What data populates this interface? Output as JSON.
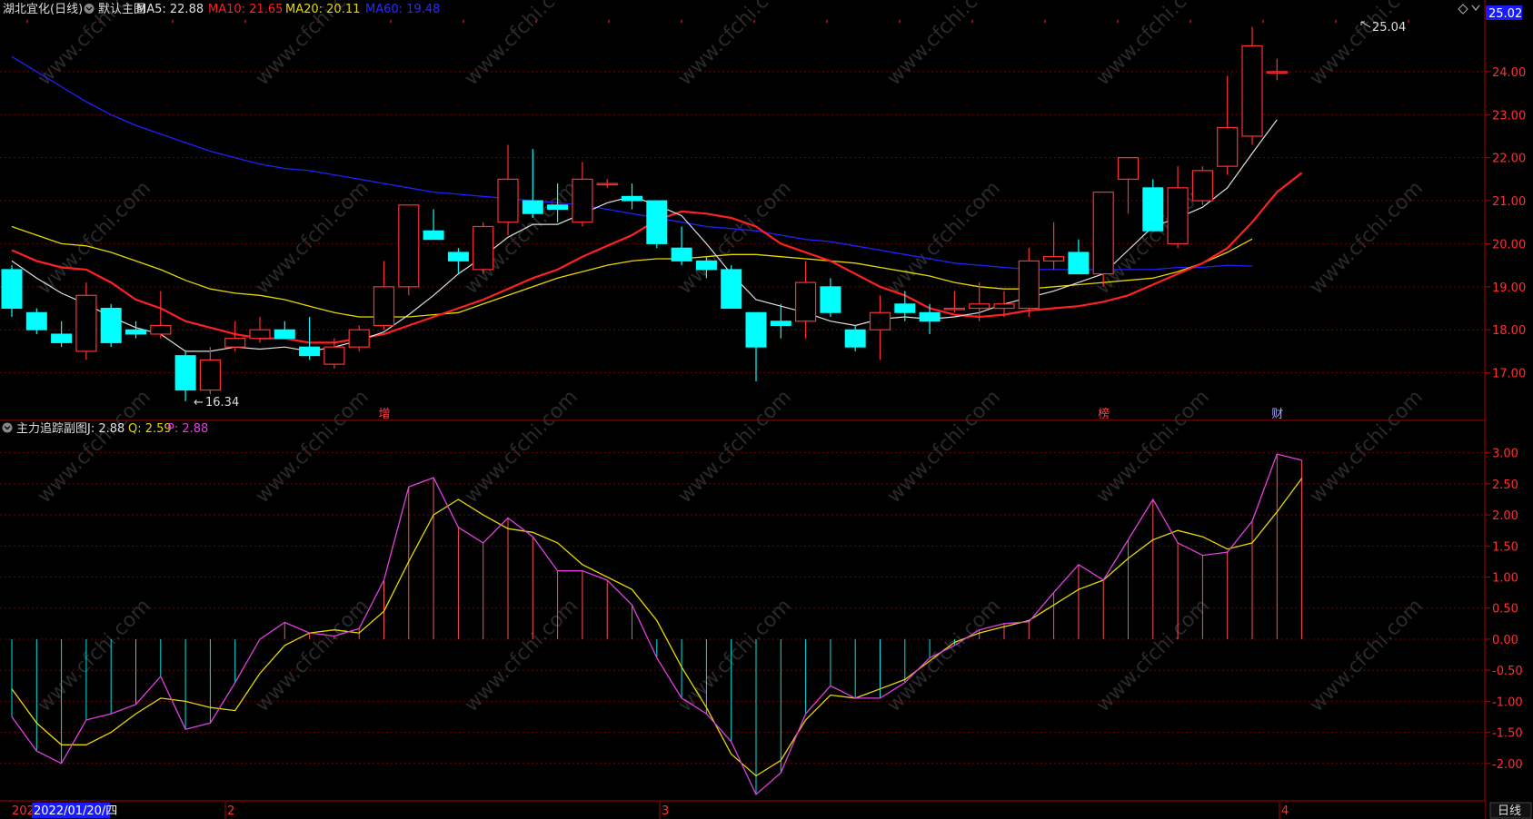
{
  "header": {
    "stock": "湖北宜化(日线)",
    "main_chart": "默认主图",
    "ma5": {
      "label": "MA5: 22.88",
      "color": "#e0e0e0"
    },
    "ma10": {
      "label": "MA10: 21.65",
      "color": "#ff2020"
    },
    "ma20": {
      "label": "MA20: 20.11",
      "color": "#e6d800"
    },
    "ma60": {
      "label": "MA60: 19.48",
      "color": "#2020ff"
    },
    "price_badge": "25.02"
  },
  "sub_header": {
    "title": "主力追踪副图",
    "j": {
      "label": "J: 2.88",
      "color": "#e0e0e0"
    },
    "q": {
      "label": "Q: 2.59",
      "color": "#e6d800"
    },
    "p": {
      "label": "P: 2.88",
      "color": "#e040e0"
    }
  },
  "markers": {
    "low_label": "16.34",
    "high_label": "25.04",
    "events": [
      {
        "index": 15,
        "text": "增"
      },
      {
        "index": 44,
        "text": "榜"
      },
      {
        "index": 51,
        "text": "财"
      }
    ]
  },
  "bottom_bar": {
    "date_prefix": "202",
    "date_label": "2022/01/20/四",
    "month_2": "2",
    "month_3": "3",
    "month_4": "4",
    "period": "日线"
  },
  "watermark": "www.cfchi.com",
  "colors": {
    "up": "#ff3030",
    "down": "#00ffff",
    "grid": "#7a0000",
    "axis": "#b00000",
    "bg": "#000000"
  },
  "chart_data": [
    {
      "type": "candlestick",
      "title": "湖北宜化(日线)",
      "ylim": [
        16.0,
        25.2
      ],
      "yticks": [
        "17.00",
        "18.00",
        "19.00",
        "20.00",
        "21.00",
        "22.00",
        "23.00",
        "24.00"
      ],
      "candles": [
        {
          "o": 19.4,
          "h": 19.5,
          "l": 18.3,
          "c": 18.5
        },
        {
          "o": 18.4,
          "h": 18.5,
          "l": 17.9,
          "c": 18.0
        },
        {
          "o": 17.9,
          "h": 18.2,
          "l": 17.6,
          "c": 17.7
        },
        {
          "o": 17.5,
          "h": 19.1,
          "l": 17.3,
          "c": 18.8
        },
        {
          "o": 18.5,
          "h": 18.6,
          "l": 17.6,
          "c": 17.7
        },
        {
          "o": 18.0,
          "h": 18.2,
          "l": 17.8,
          "c": 17.9
        },
        {
          "o": 17.9,
          "h": 18.9,
          "l": 17.8,
          "c": 18.1
        },
        {
          "o": 17.4,
          "h": 17.5,
          "l": 16.34,
          "c": 16.6
        },
        {
          "o": 16.6,
          "h": 17.6,
          "l": 16.5,
          "c": 17.3
        },
        {
          "o": 17.6,
          "h": 18.2,
          "l": 17.5,
          "c": 17.8
        },
        {
          "o": 17.8,
          "h": 18.3,
          "l": 17.7,
          "c": 18.0
        },
        {
          "o": 18.0,
          "h": 18.2,
          "l": 17.8,
          "c": 17.8
        },
        {
          "o": 17.6,
          "h": 18.3,
          "l": 17.3,
          "c": 17.4
        },
        {
          "o": 17.2,
          "h": 17.8,
          "l": 17.1,
          "c": 17.6
        },
        {
          "o": 17.6,
          "h": 18.1,
          "l": 17.5,
          "c": 18.0
        },
        {
          "o": 18.1,
          "h": 19.6,
          "l": 18.0,
          "c": 19.0
        },
        {
          "o": 19.0,
          "h": 20.9,
          "l": 18.8,
          "c": 20.9
        },
        {
          "o": 20.3,
          "h": 20.8,
          "l": 20.1,
          "c": 20.1
        },
        {
          "o": 19.8,
          "h": 19.9,
          "l": 19.3,
          "c": 19.6
        },
        {
          "o": 19.4,
          "h": 20.5,
          "l": 19.3,
          "c": 20.4
        },
        {
          "o": 20.5,
          "h": 22.3,
          "l": 20.2,
          "c": 21.5
        },
        {
          "o": 21.0,
          "h": 22.2,
          "l": 20.6,
          "c": 20.7
        },
        {
          "o": 20.9,
          "h": 21.4,
          "l": 20.5,
          "c": 20.8
        },
        {
          "o": 20.5,
          "h": 21.9,
          "l": 20.4,
          "c": 21.5
        },
        {
          "o": 21.4,
          "h": 21.5,
          "l": 21.3,
          "c": 21.4
        },
        {
          "o": 21.1,
          "h": 21.4,
          "l": 20.8,
          "c": 21.0
        },
        {
          "o": 21.0,
          "h": 21.0,
          "l": 19.9,
          "c": 20.0
        },
        {
          "o": 19.9,
          "h": 20.4,
          "l": 19.5,
          "c": 19.6
        },
        {
          "o": 19.6,
          "h": 19.7,
          "l": 19.2,
          "c": 19.4
        },
        {
          "o": 19.4,
          "h": 19.5,
          "l": 18.6,
          "c": 18.5
        },
        {
          "o": 18.4,
          "h": 18.4,
          "l": 16.8,
          "c": 17.6
        },
        {
          "o": 18.2,
          "h": 18.6,
          "l": 17.8,
          "c": 18.1
        },
        {
          "o": 18.2,
          "h": 19.6,
          "l": 17.8,
          "c": 19.1
        },
        {
          "o": 19.0,
          "h": 19.2,
          "l": 18.3,
          "c": 18.4
        },
        {
          "o": 18.0,
          "h": 18.1,
          "l": 17.5,
          "c": 17.6
        },
        {
          "o": 18.0,
          "h": 18.8,
          "l": 17.3,
          "c": 18.4
        },
        {
          "o": 18.6,
          "h": 18.9,
          "l": 18.2,
          "c": 18.4
        },
        {
          "o": 18.4,
          "h": 18.6,
          "l": 17.9,
          "c": 18.2
        },
        {
          "o": 18.5,
          "h": 18.9,
          "l": 18.4,
          "c": 18.5
        },
        {
          "o": 18.5,
          "h": 19.1,
          "l": 18.2,
          "c": 18.6
        },
        {
          "o": 18.5,
          "h": 18.9,
          "l": 18.3,
          "c": 18.6
        },
        {
          "o": 18.5,
          "h": 19.9,
          "l": 18.3,
          "c": 19.6
        },
        {
          "o": 19.6,
          "h": 20.5,
          "l": 19.4,
          "c": 19.7
        },
        {
          "o": 19.8,
          "h": 20.1,
          "l": 19.3,
          "c": 19.3
        },
        {
          "o": 19.3,
          "h": 21.2,
          "l": 19.0,
          "c": 21.2
        },
        {
          "o": 21.5,
          "h": 22.0,
          "l": 20.7,
          "c": 22.0
        },
        {
          "o": 21.3,
          "h": 21.5,
          "l": 20.3,
          "c": 20.3
        },
        {
          "o": 20.0,
          "h": 21.8,
          "l": 19.9,
          "c": 21.3
        },
        {
          "o": 21.0,
          "h": 21.8,
          "l": 20.9,
          "c": 21.7
        },
        {
          "o": 21.8,
          "h": 23.9,
          "l": 21.6,
          "c": 22.7
        },
        {
          "o": 22.5,
          "h": 25.04,
          "l": 22.3,
          "c": 24.6
        },
        {
          "o": 24.0,
          "h": 24.3,
          "l": 23.8,
          "c": 24.0
        }
      ],
      "ma5": [
        19.6,
        19.2,
        18.85,
        18.6,
        18.3,
        18.05,
        17.9,
        17.5,
        17.5,
        17.6,
        17.55,
        17.6,
        17.5,
        17.6,
        17.75,
        17.95,
        18.35,
        18.8,
        19.3,
        19.7,
        20.15,
        20.45,
        20.45,
        20.7,
        20.95,
        21.1,
        20.9,
        20.65,
        20.0,
        19.3,
        18.7,
        18.55,
        18.4,
        18.2,
        18.1,
        18.25,
        18.3,
        18.25,
        18.3,
        18.4,
        18.6,
        18.75,
        18.9,
        19.1,
        19.3,
        19.85,
        20.4,
        20.6,
        20.85,
        21.3,
        22.1,
        22.88
      ],
      "ma10": [
        19.85,
        19.6,
        19.45,
        19.4,
        19.1,
        18.7,
        18.5,
        18.2,
        18.05,
        17.9,
        17.8,
        17.8,
        17.7,
        17.7,
        17.8,
        17.9,
        18.1,
        18.3,
        18.5,
        18.7,
        18.95,
        19.2,
        19.4,
        19.7,
        19.95,
        20.2,
        20.55,
        20.75,
        20.7,
        20.6,
        20.4,
        20.0,
        19.8,
        19.6,
        19.3,
        19.0,
        18.8,
        18.5,
        18.35,
        18.3,
        18.35,
        18.45,
        18.5,
        18.55,
        18.65,
        18.8,
        19.05,
        19.3,
        19.55,
        19.9,
        20.5,
        21.2,
        21.65
      ],
      "ma20": [
        20.4,
        20.2,
        20.0,
        19.95,
        19.8,
        19.6,
        19.4,
        19.15,
        18.95,
        18.85,
        18.8,
        18.7,
        18.55,
        18.4,
        18.3,
        18.3,
        18.3,
        18.35,
        18.4,
        18.6,
        18.8,
        19.0,
        19.2,
        19.35,
        19.5,
        19.6,
        19.65,
        19.65,
        19.7,
        19.75,
        19.75,
        19.7,
        19.65,
        19.6,
        19.55,
        19.45,
        19.35,
        19.25,
        19.1,
        19.0,
        18.95,
        18.95,
        19.0,
        19.05,
        19.1,
        19.15,
        19.2,
        19.35,
        19.55,
        19.8,
        20.11
      ],
      "ma60": [
        24.35,
        24.0,
        23.65,
        23.3,
        23.0,
        22.75,
        22.55,
        22.35,
        22.15,
        22.0,
        21.85,
        21.75,
        21.7,
        21.6,
        21.5,
        21.4,
        21.3,
        21.2,
        21.15,
        21.1,
        21.05,
        21.0,
        20.95,
        20.9,
        20.8,
        20.7,
        20.6,
        20.5,
        20.4,
        20.35,
        20.3,
        20.2,
        20.1,
        20.05,
        19.95,
        19.85,
        19.75,
        19.65,
        19.55,
        19.5,
        19.45,
        19.4,
        19.4,
        19.4,
        19.4,
        19.4,
        19.4,
        19.45,
        19.45,
        19.5,
        19.48
      ]
    },
    {
      "type": "line",
      "title": "主力追踪副图",
      "ylim": [
        -2.5,
        3.2
      ],
      "yticks": [
        "3.00",
        "2.50",
        "2.00",
        "1.50",
        "1.00",
        "0.50",
        "0.00",
        "-0.50",
        "-1.00",
        "-1.50",
        "-2.00"
      ],
      "series": [
        {
          "name": "J",
          "values": [
            -1.25,
            -1.8,
            -2.0,
            -1.3,
            -1.2,
            -1.05,
            -0.6,
            -1.45,
            -1.35,
            -0.7,
            0.0,
            0.27,
            0.1,
            0.05,
            0.17,
            0.95,
            2.45,
            2.6,
            1.8,
            1.55,
            1.95,
            1.65,
            1.1,
            1.1,
            0.95,
            0.55,
            -0.3,
            -0.95,
            -1.2,
            -1.65,
            -2.5,
            -2.15,
            -1.2,
            -0.75,
            -0.95,
            -0.95,
            -0.7,
            -0.3,
            -0.1,
            0.15,
            0.25,
            0.28,
            0.75,
            1.2,
            0.95,
            1.6,
            2.25,
            1.55,
            1.35,
            1.4,
            1.9,
            2.98,
            2.88
          ]
        },
        {
          "name": "Q",
          "values": [
            -0.8,
            -1.35,
            -1.7,
            -1.7,
            -1.5,
            -1.2,
            -0.95,
            -1.0,
            -1.1,
            -1.15,
            -0.55,
            -0.1,
            0.1,
            0.15,
            0.1,
            0.45,
            1.25,
            2.0,
            2.25,
            2.0,
            1.78,
            1.72,
            1.55,
            1.2,
            1.0,
            0.8,
            0.3,
            -0.45,
            -1.1,
            -1.85,
            -2.2,
            -1.95,
            -1.3,
            -0.9,
            -0.95,
            -0.8,
            -0.65,
            -0.35,
            -0.05,
            0.1,
            0.2,
            0.3,
            0.55,
            0.8,
            0.95,
            1.3,
            1.6,
            1.75,
            1.65,
            1.45,
            1.55,
            2.05,
            2.59
          ]
        }
      ]
    }
  ]
}
